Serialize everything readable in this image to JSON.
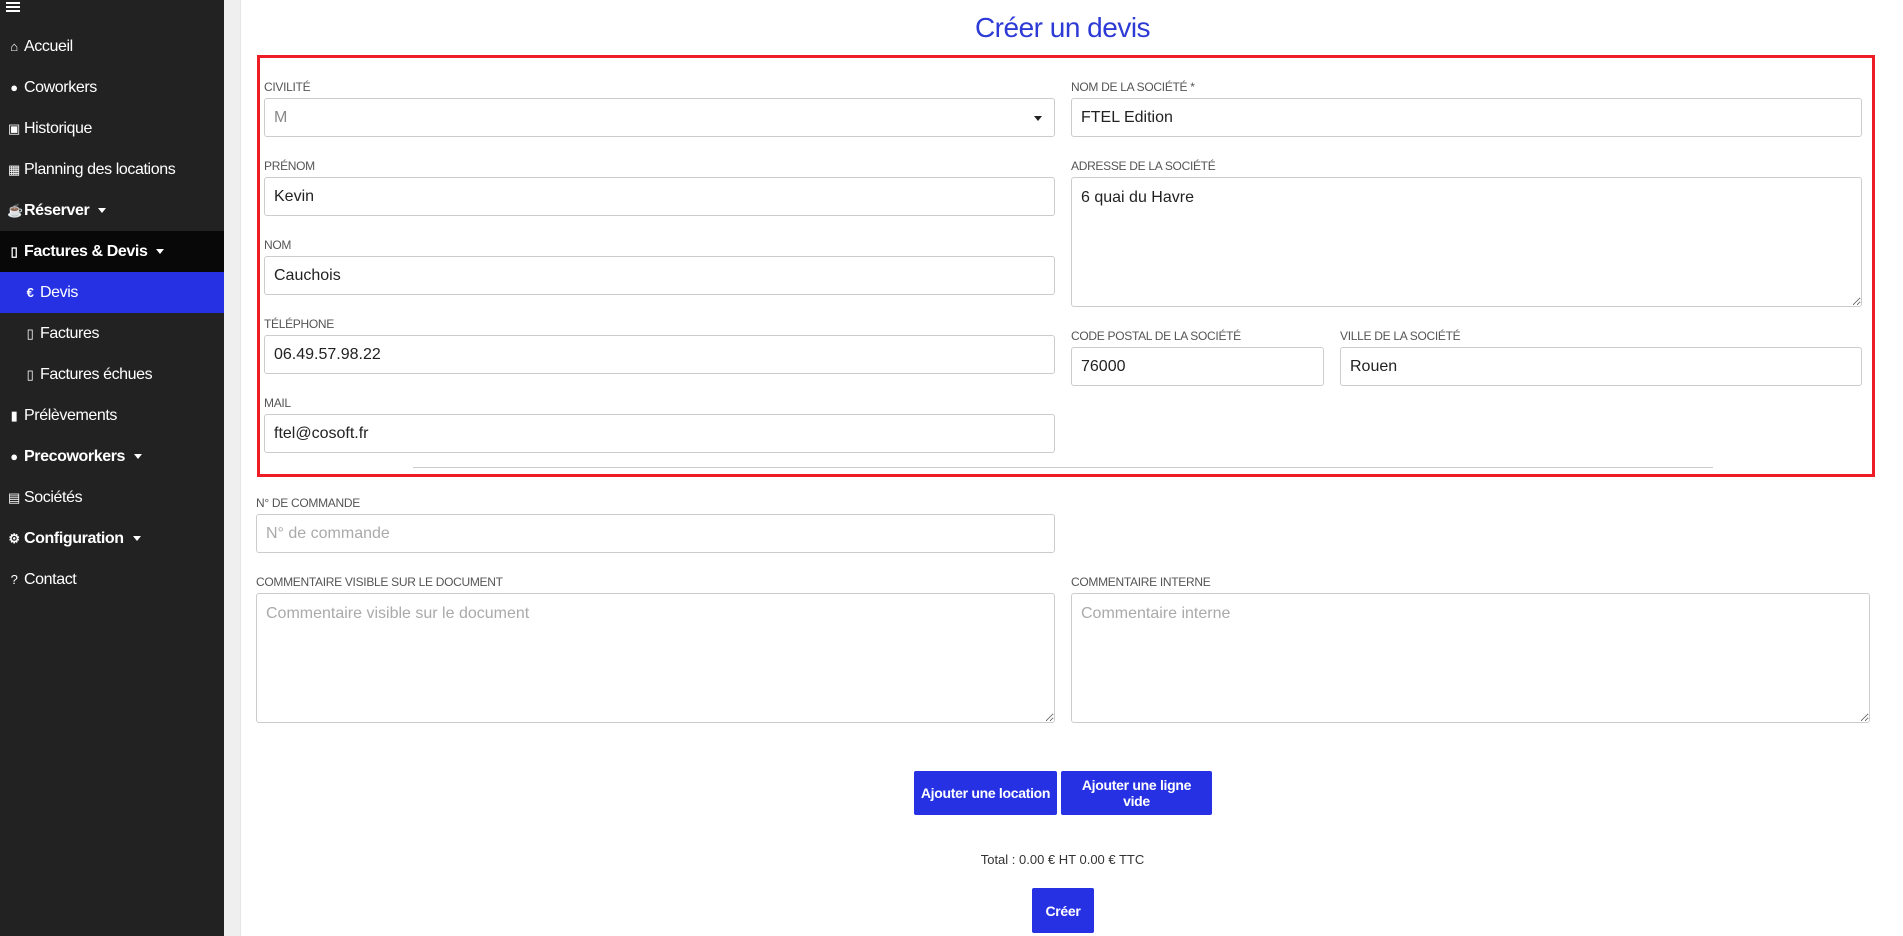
{
  "sidebar": {
    "items": [
      {
        "label": "Accueil",
        "icon": "home-icon",
        "glyph": "⌂"
      },
      {
        "label": "Coworkers",
        "icon": "user-icon",
        "glyph": "👤"
      },
      {
        "label": "Historique",
        "icon": "money-icon",
        "glyph": "▣"
      },
      {
        "label": "Planning des locations",
        "icon": "calendar-icon",
        "glyph": "▦"
      },
      {
        "label": "Réserver",
        "icon": "coffee-icon",
        "glyph": "☕"
      },
      {
        "label": "Factures & Devis",
        "icon": "pdf-icon",
        "glyph": "▯"
      },
      {
        "label": "Devis",
        "icon": "euro-icon",
        "glyph": "€"
      },
      {
        "label": "Factures",
        "icon": "pdf-icon",
        "glyph": "▯"
      },
      {
        "label": "Factures échues",
        "icon": "pdf-icon",
        "glyph": "▯"
      },
      {
        "label": "Prélèvements",
        "icon": "file-icon",
        "glyph": "▮"
      },
      {
        "label": "Precoworkers",
        "icon": "user-icon",
        "glyph": "👤"
      },
      {
        "label": "Sociétés",
        "icon": "building-icon",
        "glyph": "▤"
      },
      {
        "label": "Configuration",
        "icon": "cogs-icon",
        "glyph": "⚙"
      },
      {
        "label": "Contact",
        "icon": "question-circle-icon",
        "glyph": "?"
      }
    ]
  },
  "page": {
    "title": "Créer un devis"
  },
  "form": {
    "civilite_label": "Civilité",
    "civilite_value": "M",
    "prenom_label": "Prénom",
    "prenom_value": "Kevin",
    "nom_label": "Nom",
    "nom_value": "Cauchois",
    "telephone_label": "Téléphone",
    "telephone_value": "06.49.57.98.22",
    "mail_label": "Mail",
    "mail_value": "ftel@cosoft.fr",
    "societe_nom_label": "Nom de la société *",
    "societe_nom_value": "FTEL Edition",
    "societe_adresse_label": "Adresse de la société",
    "societe_adresse_value": "6 quai du Havre",
    "code_postal_label": "Code postal de la société",
    "code_postal_value": "76000",
    "ville_label": "Ville de la société",
    "ville_value": "Rouen",
    "commande_label": "N° de commande",
    "commande_placeholder": "N° de commande",
    "commentaire_visible_label": "Commentaire visible sur le document",
    "commentaire_visible_placeholder": "Commentaire visible sur le document",
    "commentaire_interne_label": "Commentaire interne",
    "commentaire_interne_placeholder": "Commentaire interne"
  },
  "actions": {
    "add_location": "Ajouter une location",
    "add_empty_line": "Ajouter une ligne vide",
    "total": "Total : 0.00 € HT 0.00 € TTC",
    "create": "Créer"
  },
  "colors": {
    "accent": "#2531e3",
    "highlight_border": "#ee1c24",
    "sidebar_bg": "#222222"
  }
}
